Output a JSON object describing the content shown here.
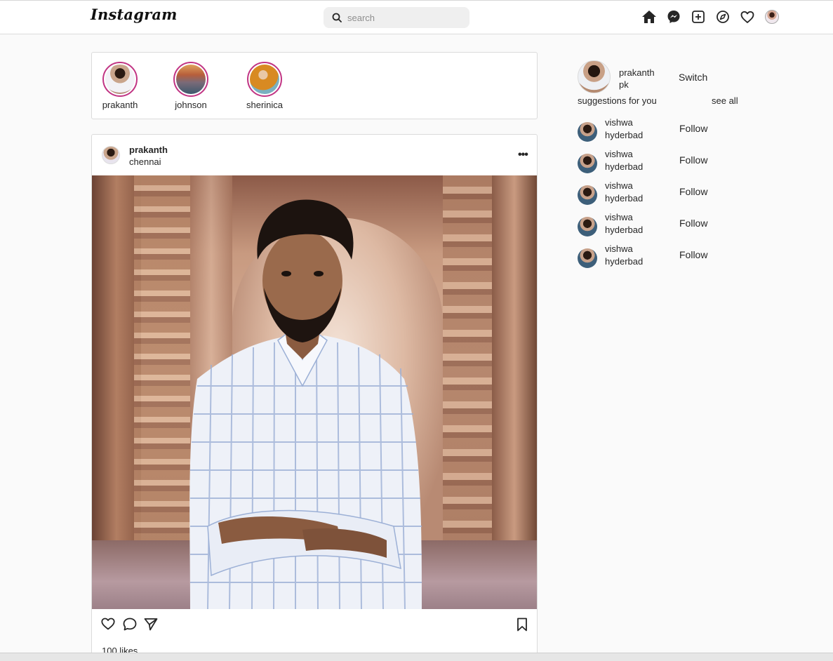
{
  "nav": {
    "logo": "Instagram",
    "search_placeholder": "search",
    "icons": [
      "home-icon",
      "messenger-icon",
      "new-post-icon",
      "explore-icon",
      "activity-heart-icon",
      "profile-avatar"
    ]
  },
  "stories": [
    {
      "username": "prakanth"
    },
    {
      "username": "johnson"
    },
    {
      "username": "sherinica"
    }
  ],
  "post": {
    "username": "prakanth",
    "location": "chennai",
    "more_label": "•••",
    "likes": "100 likes"
  },
  "sidebar": {
    "me": {
      "name": "prakanth pk",
      "switch_label": "Switch"
    },
    "suggestions_title": "suggestions for you",
    "see_all": "see all",
    "suggestions": [
      {
        "name": "vishwa",
        "sub": "hyderbad",
        "action": "Follow"
      },
      {
        "name": "vishwa",
        "sub": "hyderbad",
        "action": "Follow"
      },
      {
        "name": "vishwa",
        "sub": "hyderbad",
        "action": "Follow"
      },
      {
        "name": "vishwa",
        "sub": "hyderbad",
        "action": "Follow"
      },
      {
        "name": "vishwa",
        "sub": "hyderbad",
        "action": "Follow"
      }
    ]
  },
  "colors": {
    "story_ring": "#c13584",
    "border": "#dbdbdb",
    "background": "#fafafa"
  }
}
